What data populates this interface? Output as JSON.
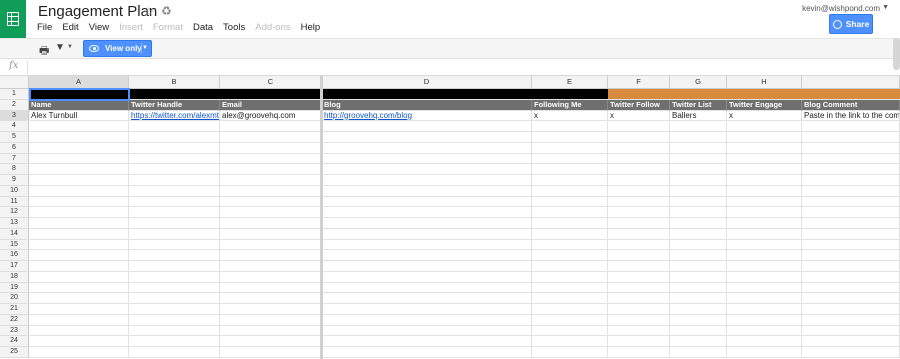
{
  "app": {
    "title": "Engagement Plan",
    "account": "kevin@wishpond.com",
    "share_label": "Share",
    "menu": [
      {
        "label": "File",
        "disabled": false
      },
      {
        "label": "Edit",
        "disabled": false
      },
      {
        "label": "View",
        "disabled": false
      },
      {
        "label": "Insert",
        "disabled": true
      },
      {
        "label": "Format",
        "disabled": true
      },
      {
        "label": "Data",
        "disabled": false
      },
      {
        "label": "Tools",
        "disabled": false
      },
      {
        "label": "Add-ons",
        "disabled": true
      },
      {
        "label": "Help",
        "disabled": false
      }
    ]
  },
  "toolbar": {
    "view_only_label": "View only"
  },
  "formula": {
    "fx_label": "fx"
  },
  "sheet": {
    "columns": [
      "A",
      "B",
      "C",
      "D",
      "E",
      "F",
      "G",
      "H",
      ""
    ],
    "headers": [
      "Name",
      "Twitter Handle",
      "Email",
      "Blog",
      "Following Me",
      "Twitter Follow",
      "Twitter List",
      "Twitter Engage",
      "Blog Comment"
    ],
    "row3": [
      "Alex Turnbull",
      "https://twitter.com/alexmturnbull",
      "alex@groovehq.com",
      "http://groovehq.com/blog",
      "x",
      "x",
      "Ballers",
      "x",
      "Paste in the link to the comment"
    ],
    "row_numbers": [
      "1",
      "2",
      "3",
      "4",
      "5",
      "6",
      "7",
      "8",
      "9",
      "10",
      "11",
      "12",
      "13",
      "14",
      "15",
      "16",
      "17",
      "18",
      "19",
      "20",
      "21",
      "22",
      "23",
      "24",
      "25"
    ]
  },
  "colors": {
    "brand_green": "#0f9d58",
    "accent_blue": "#4d90fe",
    "header_gray": "#6f6f6f",
    "band_orange": "#d88b3f",
    "link_blue": "#1155cc"
  },
  "icons": [
    "sheets-logo-icon",
    "star-icon",
    "move-to-folder-icon",
    "globe-icon",
    "print-icon",
    "filter-icon",
    "eye-icon",
    "fx-icon"
  ]
}
